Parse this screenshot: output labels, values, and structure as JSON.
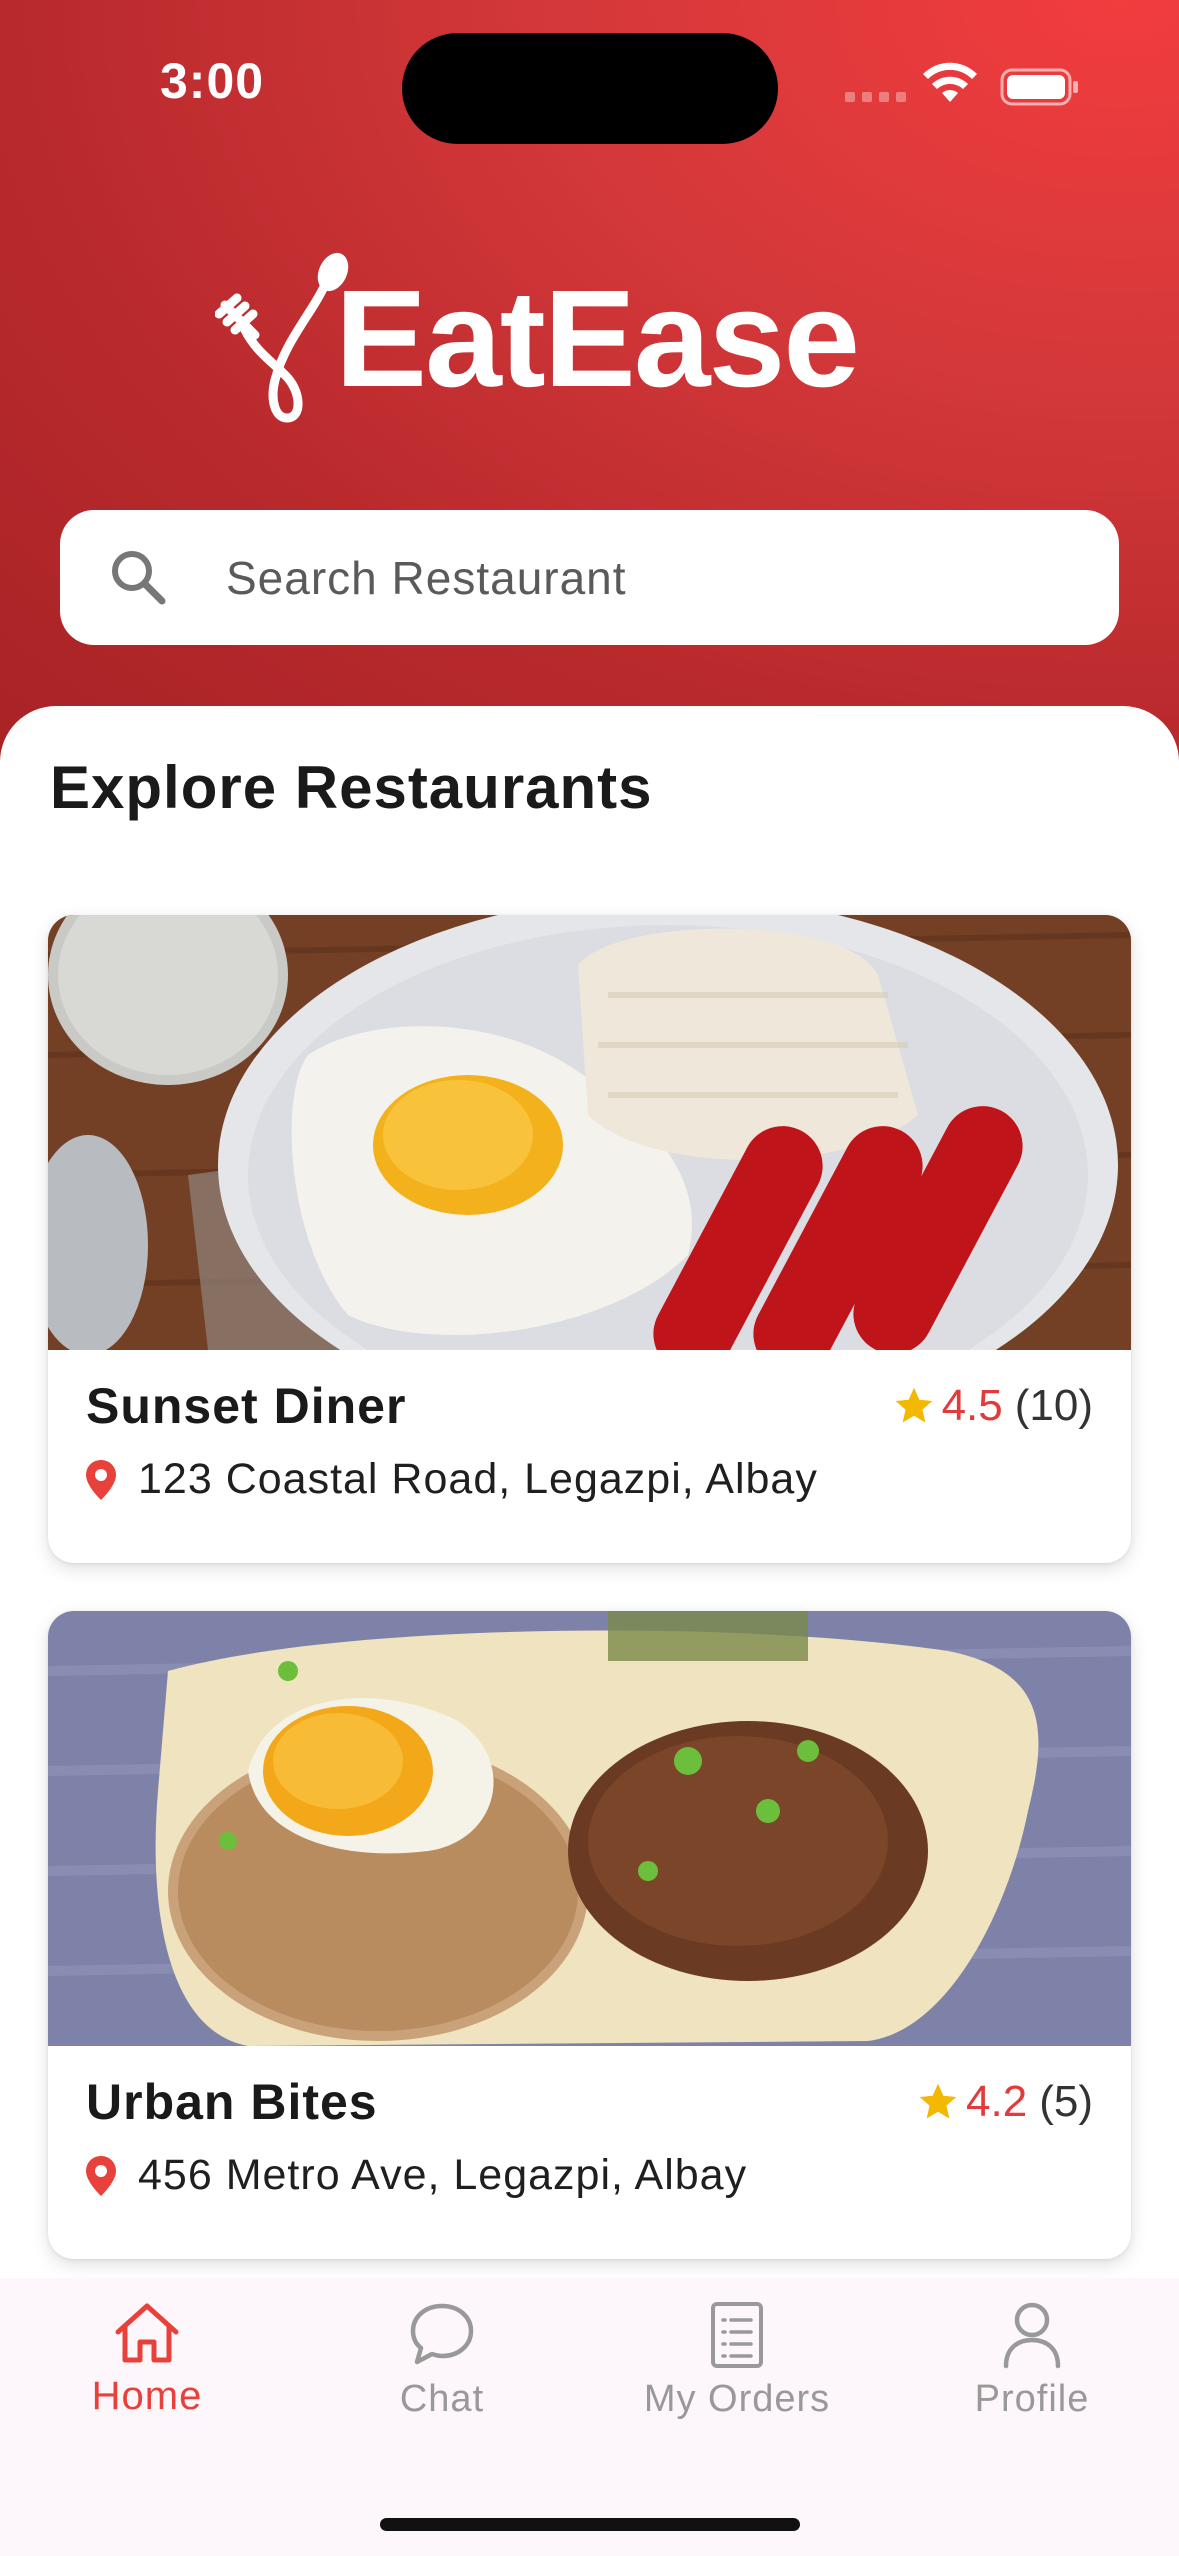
{
  "status_bar": {
    "time": "3:00"
  },
  "brand": {
    "name": "EatEase"
  },
  "search": {
    "placeholder": "Search Restaurant"
  },
  "section": {
    "title": "Explore Restaurants"
  },
  "restaurants": [
    {
      "name": "Sunset Diner",
      "rating": "4.5",
      "reviews": "(10)",
      "address": "123 Coastal Road, Legazpi, Albay"
    },
    {
      "name": "Urban Bites",
      "rating": "4.2",
      "reviews": "(5)",
      "address": "456 Metro Ave, Legazpi, Albay"
    }
  ],
  "tabs": [
    {
      "label": "Home",
      "icon": "home-icon",
      "active": true
    },
    {
      "label": "Chat",
      "icon": "chat-icon",
      "active": false
    },
    {
      "label": "My Orders",
      "icon": "orders-icon",
      "active": false
    },
    {
      "label": "Profile",
      "icon": "profile-icon",
      "active": false
    }
  ],
  "colors": {
    "brand_red": "#c62f32",
    "accent": "#e8413c",
    "star": "#f5b800"
  }
}
